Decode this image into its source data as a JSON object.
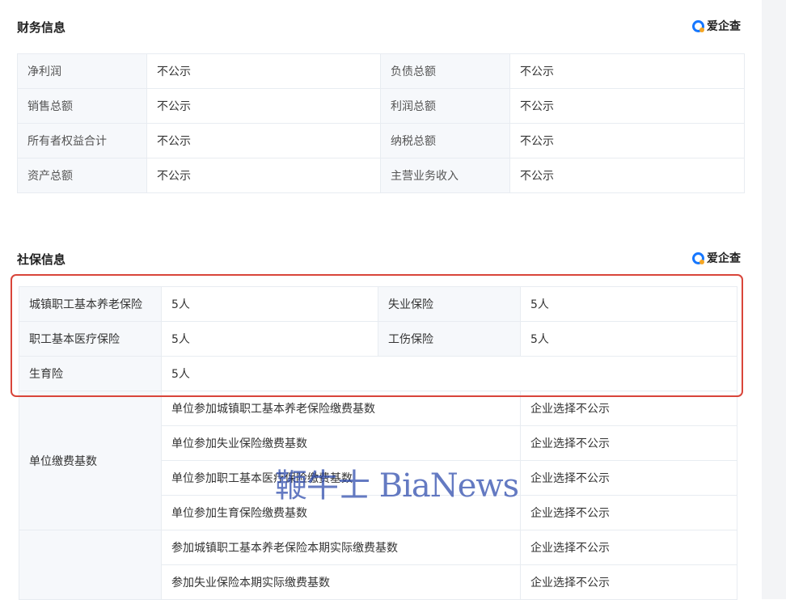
{
  "finance": {
    "title": "财务信息",
    "brand": "爱企查",
    "rows": [
      [
        "净利润",
        "不公示",
        "负债总额",
        "不公示"
      ],
      [
        "销售总额",
        "不公示",
        "利润总额",
        "不公示"
      ],
      [
        "所有者权益合计",
        "不公示",
        "纳税总额",
        "不公示"
      ],
      [
        "资产总额",
        "不公示",
        "主营业务收入",
        "不公示"
      ]
    ]
  },
  "social": {
    "title": "社保信息",
    "brand": "爱企查",
    "rows": [
      [
        "城镇职工基本养老保险",
        "5人",
        "失业保险",
        "5人"
      ],
      [
        "职工基本医疗保险",
        "5人",
        "工伤保险",
        "5人"
      ],
      [
        "生育险",
        "5人"
      ]
    ],
    "groups": [
      {
        "label": "单位缴费基数",
        "items": [
          [
            "单位参加城镇职工基本养老保险缴费基数",
            "企业选择不公示"
          ],
          [
            "单位参加失业保险缴费基数",
            "企业选择不公示"
          ],
          [
            "单位参加职工基本医疗保险缴费基数",
            "企业选择不公示"
          ],
          [
            "单位参加生育保险缴费基数",
            "企业选择不公示"
          ]
        ]
      },
      {
        "label": "",
        "items": [
          [
            "参加城镇职工基本养老保险本期实际缴费基数",
            "企业选择不公示"
          ],
          [
            "参加失业保险本期实际缴费基数",
            "企业选择不公示"
          ]
        ]
      }
    ]
  },
  "watermark": "鞭牛士 BiaNews",
  "colors": {
    "highlight": "#d9453a",
    "brand": "#1677ff",
    "key_bg": "#f6f8fb"
  }
}
